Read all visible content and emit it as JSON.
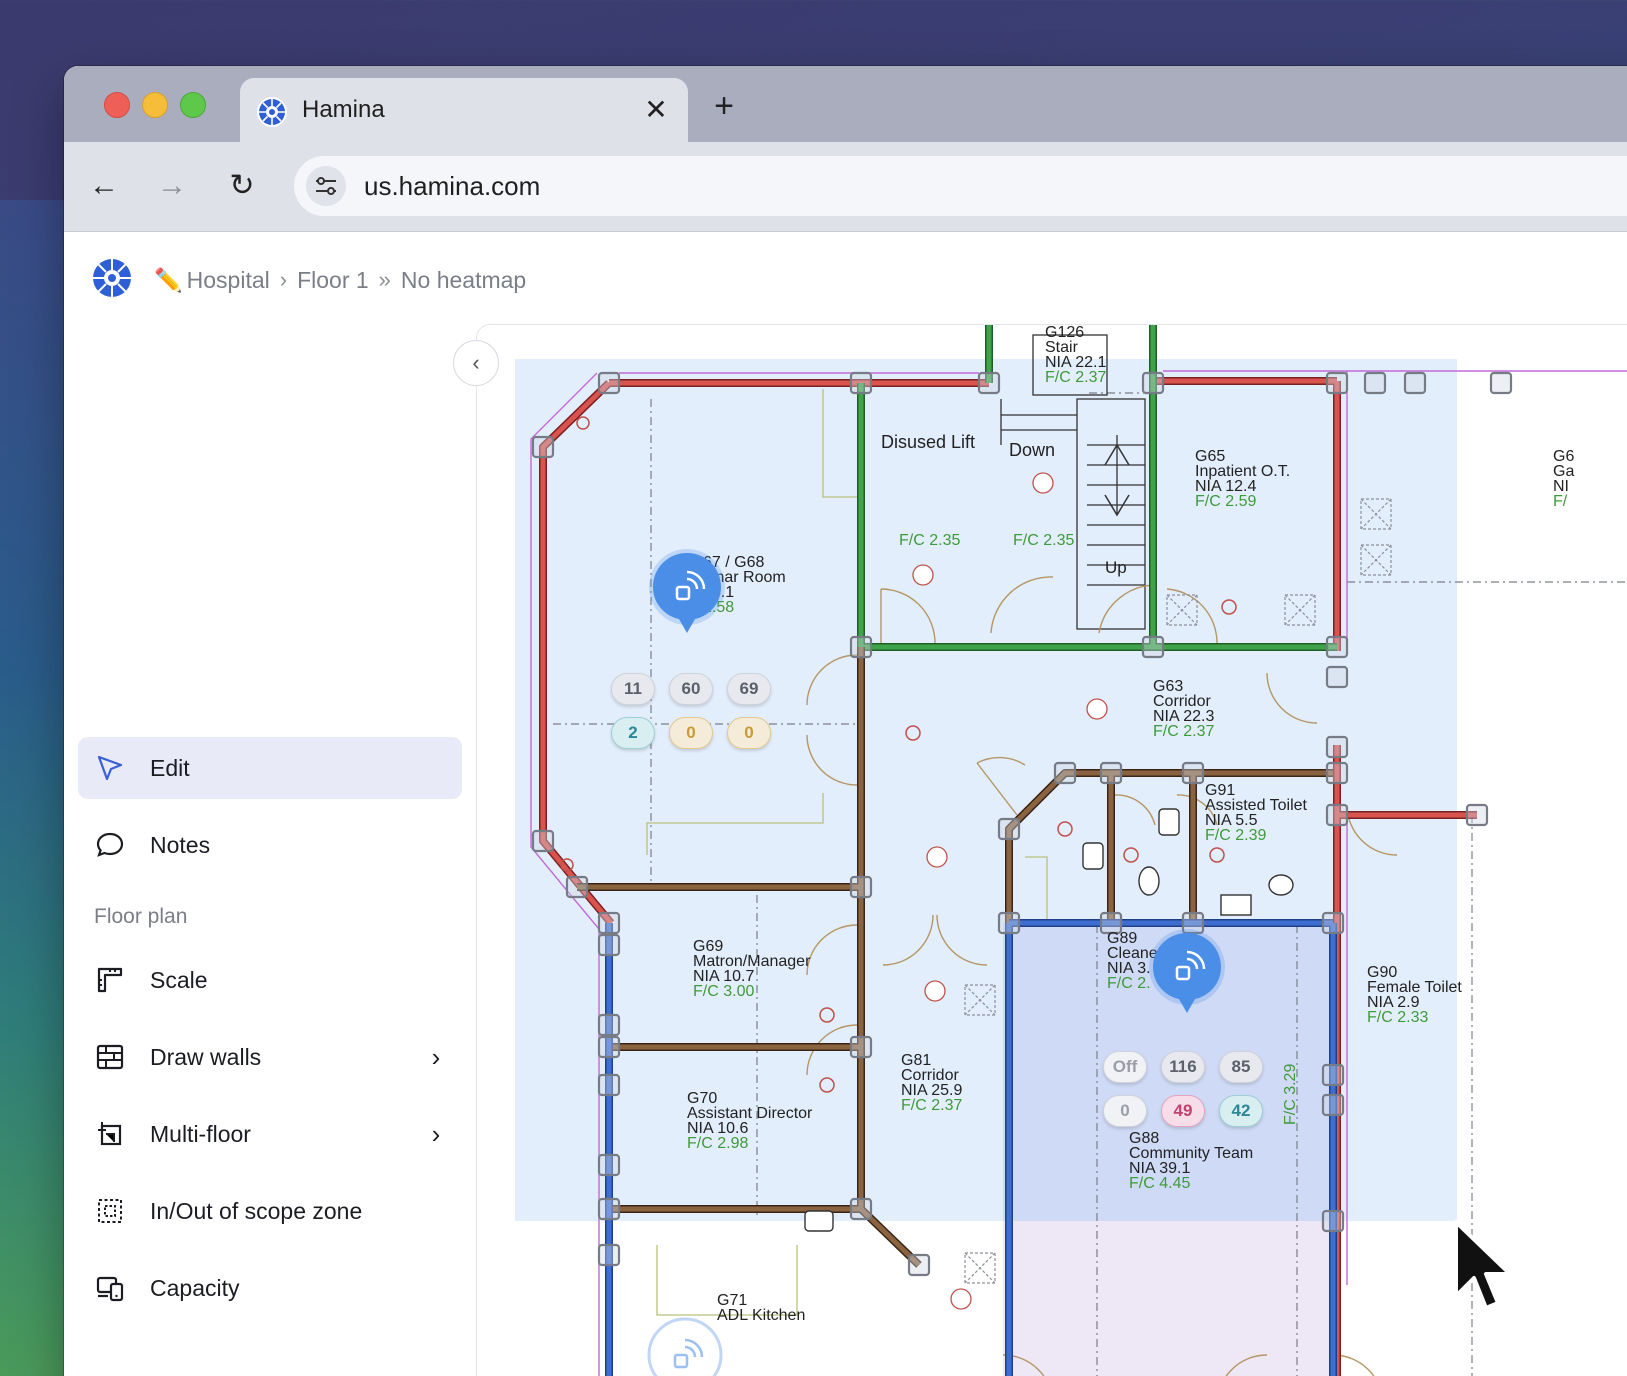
{
  "browser": {
    "tab_title": "Hamina",
    "tab_close": "✕",
    "new_tab": "+",
    "url": "us.hamina.com",
    "nav_back": "←",
    "nav_forward": "→",
    "nav_reload": "↻",
    "icons": [
      "favicon-icon",
      "close-icon",
      "plus-icon",
      "back-arrow-icon",
      "forward-arrow-icon",
      "reload-icon",
      "site-settings-icon"
    ]
  },
  "app": {
    "breadcrumb": {
      "pencil": "✏️",
      "project": "Hospital",
      "sep1": "›",
      "floor": "Floor 1",
      "sep2": "»",
      "view": "No heatmap"
    },
    "collapse_label": "‹"
  },
  "sidebar": {
    "items": [
      {
        "label": "Edit",
        "icon": "cursor-arrow-icon",
        "active": true
      },
      {
        "label": "Notes",
        "icon": "speech-bubble-icon"
      }
    ],
    "section_floor_plan": "Floor plan",
    "floor_items": [
      {
        "label": "Scale",
        "icon": "ruler-icon"
      },
      {
        "label": "Draw walls",
        "icon": "wall-grid-icon",
        "chevron": "›"
      },
      {
        "label": "Multi-floor",
        "icon": "multi-floor-icon",
        "chevron": "›"
      },
      {
        "label": "In/Out of scope zone",
        "icon": "scope-zone-icon"
      },
      {
        "label": "Capacity",
        "icon": "devices-icon"
      }
    ]
  },
  "floorplan": {
    "rooms": [
      {
        "lines": [
          "G126",
          "Stair",
          "NIA 22.1"
        ],
        "fc": "F/C 2.37"
      },
      {
        "lines": [
          "Disused Lift"
        ],
        "fc": ""
      },
      {
        "lines": [
          "Down"
        ],
        "fc": ""
      },
      {
        "lines": [
          "Up"
        ],
        "fc": ""
      },
      {
        "lines": [
          "G65",
          "Inpatient O.T.",
          "NIA 12.4"
        ],
        "fc": "F/C 2.59"
      },
      {
        "lines": [
          "G6",
          "Ga",
          "NI"
        ],
        "fc": "F/"
      },
      {
        "lines": [],
        "fc": "F/C 2.35"
      },
      {
        "lines": [],
        "fc": "F/C 2.35"
      },
      {
        "lines": [
          "67 / G68",
          "ninar Room",
          "44.1"
        ],
        "fc": "2.58"
      },
      {
        "lines": [
          "G63",
          "Corridor",
          "NIA 22.3"
        ],
        "fc": "F/C 2.37"
      },
      {
        "lines": [
          "G91",
          "Assisted Toilet",
          "NIA 5.5"
        ],
        "fc": "F/C 2.39"
      },
      {
        "lines": [
          "G69",
          "Matron/Manager",
          "NIA 10.7"
        ],
        "fc": "F/C 3.00"
      },
      {
        "lines": [
          "G89",
          "Cleane",
          "NIA 3."
        ],
        "fc": "F/C 2."
      },
      {
        "lines": [
          "G90",
          "Female Toilet",
          "NIA 2.9"
        ],
        "fc": "F/C 2.33"
      },
      {
        "lines": [
          "G81",
          "Corridor",
          "NIA 25.9"
        ],
        "fc": "F/C 2.37"
      },
      {
        "lines": [
          "G70",
          "Assistant Director",
          "NIA 10.6"
        ],
        "fc": "F/C 2.98"
      },
      {
        "lines": [
          "G88",
          "Community Team",
          "NIA 39.1"
        ],
        "fc": "F/C 4.45"
      },
      {
        "lines": [],
        "fc": "F/C 3.29"
      },
      {
        "lines": [
          "G71",
          "ADL Kitchen"
        ],
        "fc": ""
      }
    ],
    "access_points": [
      {
        "name": "ap-seminar-room",
        "top_badges": [
          "11",
          "60",
          "69"
        ],
        "bottom_badges": [
          "2",
          "0",
          "0"
        ]
      },
      {
        "name": "ap-community-team",
        "top_badges": [
          "Off",
          "116",
          "85"
        ],
        "bottom_badges": [
          "0",
          "49",
          "42"
        ]
      }
    ],
    "colors": {
      "zone_fill": "#e3eefc",
      "zone_fill_dark": "#cfdaf6",
      "wall_red": "#d9534f",
      "wall_green": "#3fa34a",
      "wall_brown": "#6b4a2b",
      "wall_blue": "#3d6fd1",
      "wall_purple": "#c06ad6",
      "ap_blue": "#4a8ee8"
    }
  }
}
